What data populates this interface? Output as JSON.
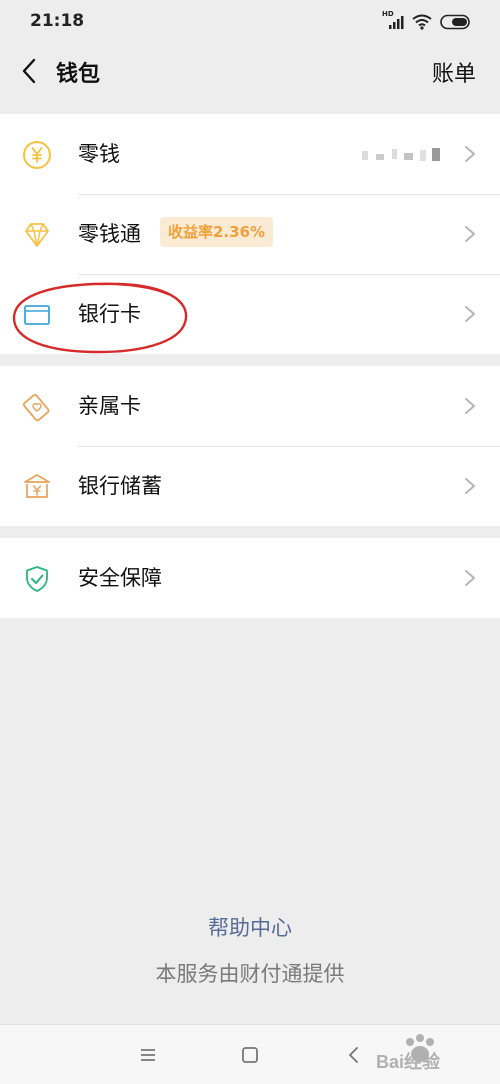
{
  "status_bar": {
    "time": "21:18",
    "hd_label": "HD"
  },
  "nav": {
    "title": "钱包",
    "right_action": "账单"
  },
  "groups": [
    {
      "items": [
        {
          "label": "零钱",
          "icon": "yuan-coin-icon"
        },
        {
          "label": "零钱通",
          "icon": "diamond-icon",
          "badge": "收益率2.36%"
        },
        {
          "label": "银行卡",
          "icon": "bank-card-icon"
        }
      ]
    },
    {
      "items": [
        {
          "label": "亲属卡",
          "icon": "family-card-icon"
        },
        {
          "label": "银行储蓄",
          "icon": "bank-savings-icon"
        }
      ]
    },
    {
      "items": [
        {
          "label": "安全保障",
          "icon": "shield-check-icon"
        }
      ]
    }
  ],
  "footer": {
    "help_link": "帮助中心",
    "provider_note": "本服务由财付通提供"
  },
  "watermark": {
    "text": "Bai经验"
  },
  "colors": {
    "background": "#ededed",
    "card": "#ffffff",
    "link": "#576b95",
    "badge_bg": "#fbead4",
    "badge_text": "#f0a13b",
    "gold_icon": "#f5c242",
    "blue_icon": "#3aa7d8",
    "orange_icon": "#e8a35a",
    "green_icon": "#2bb67d",
    "annotation_red": "#d62b2b"
  }
}
